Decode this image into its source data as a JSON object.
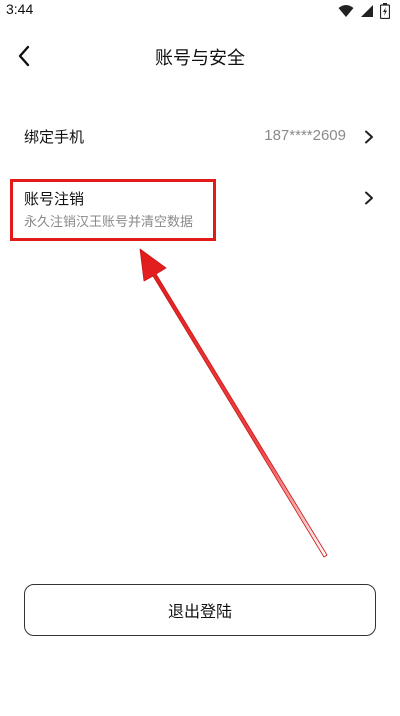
{
  "status_bar": {
    "time": "3:44",
    "icons": [
      "wifi-icon",
      "signal-icon",
      "battery-icon"
    ]
  },
  "header": {
    "title": "账号与安全",
    "back_icon": "chevron-left-icon"
  },
  "settings": {
    "items": [
      {
        "label": "绑定手机",
        "value": "187****2609",
        "icon": "chevron-right-icon"
      },
      {
        "label": "账号注销",
        "subtitle": "永久注销汉王账号并清空数据",
        "icon": "chevron-right-icon"
      }
    ]
  },
  "actions": {
    "logout_label": "退出登陆"
  },
  "annotation": {
    "highlight_color": "#e21a1a"
  }
}
